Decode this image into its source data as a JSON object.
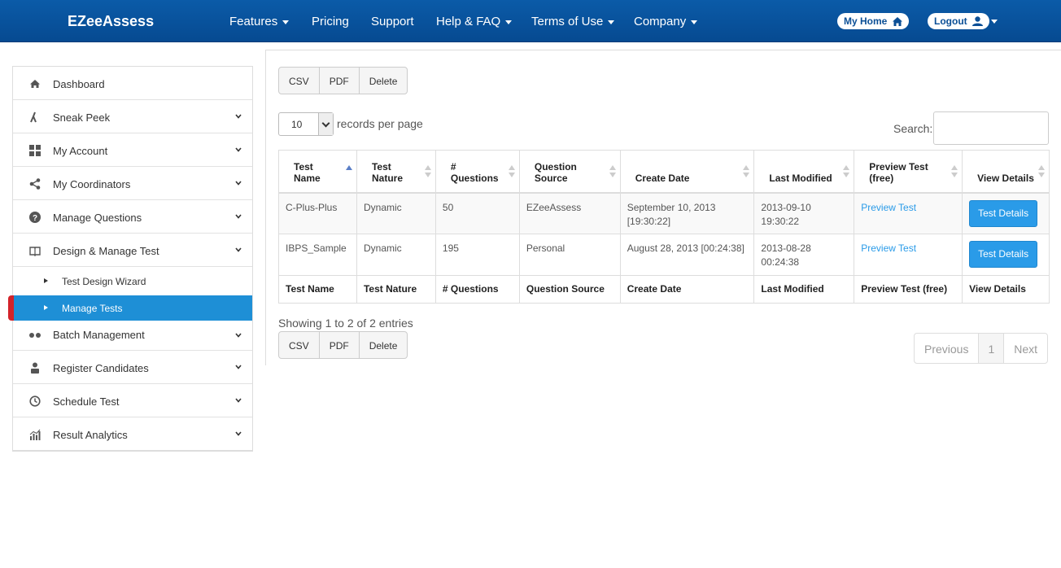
{
  "nav": {
    "brand": "EZeeAssess",
    "items": [
      "Features",
      "Pricing",
      "Support",
      "Help & FAQ",
      "Terms of Use",
      "Company"
    ],
    "my_home": "My Home",
    "logout": "Logout"
  },
  "sidebar": {
    "items": [
      {
        "label": "Dashboard",
        "icon": "home-icon"
      },
      {
        "label": "Sneak Peek",
        "icon": "graph-icon"
      },
      {
        "label": "My Account",
        "icon": "grid-icon"
      },
      {
        "label": "My Coordinators",
        "icon": "share-icon"
      },
      {
        "label": "Manage Questions",
        "icon": "question-icon"
      },
      {
        "label": "Design & Manage Test",
        "icon": "book-icon"
      },
      {
        "label": "Batch Management",
        "icon": "dots-icon"
      },
      {
        "label": "Register Candidates",
        "icon": "user-icon"
      },
      {
        "label": "Schedule Test",
        "icon": "clock-icon"
      },
      {
        "label": "Result Analytics",
        "icon": "bar-chart-icon"
      }
    ],
    "sub_items": [
      "Test Design Wizard",
      "Manage Tests"
    ]
  },
  "toolbar": {
    "csv": "CSV",
    "pdf": "PDF",
    "delete": "Delete"
  },
  "list": {
    "per_page": "10",
    "per_page_label": "records per page",
    "search_label": "Search:"
  },
  "table": {
    "headers": [
      "Test Name",
      "Test Nature",
      "# Questions",
      "Question Source",
      "Create Date",
      "Last Modified",
      "Preview Test (free)",
      "View Details"
    ],
    "rows": [
      [
        "C-Plus-Plus",
        "Dynamic",
        "50",
        "EZeeAssess",
        "September 10, 2013 [19:30:22]",
        "2013-09-10 19:30:22",
        "Preview Test",
        "Test Details"
      ],
      [
        "IBPS_Sample",
        "Dynamic",
        "195",
        "Personal",
        "August 28, 2013 [00:24:38]",
        "2013-08-28 00:24:38",
        "Preview Test",
        "Test Details"
      ]
    ]
  },
  "footer": {
    "showing": "Showing 1 to 2 of 2 entries",
    "previous": "Previous",
    "page": "1",
    "next": "Next"
  }
}
